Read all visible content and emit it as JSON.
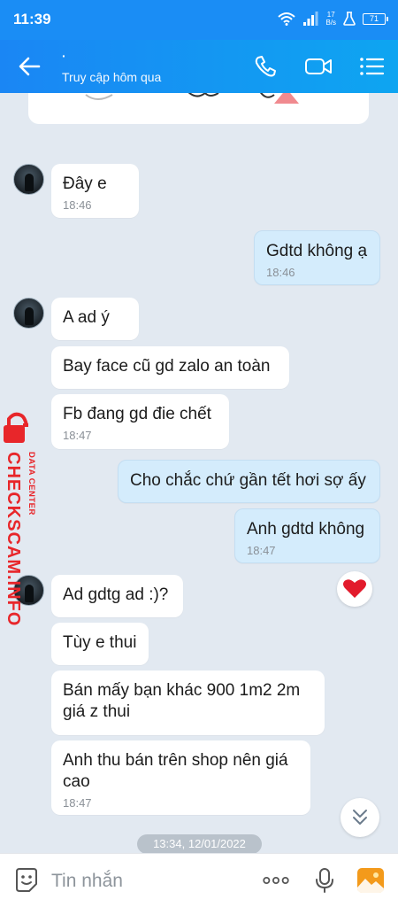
{
  "status_bar": {
    "time": "11:39",
    "net_speed_value": "17",
    "net_speed_unit": "B/s",
    "battery": "71",
    "icons": [
      "wifi-icon",
      "signal-icon",
      "flask-icon",
      "battery-icon"
    ]
  },
  "header": {
    "contact_name": "·",
    "status": "Truy cập hôm qua",
    "icons": [
      "back-arrow-icon",
      "phone-icon",
      "video-call-icon",
      "menu-list-icon"
    ],
    "accent_color": "#1a8df5"
  },
  "messages": [
    {
      "dir": "in",
      "text": "Đây e",
      "time": "18:46"
    },
    {
      "dir": "out",
      "text": "Gdtd không ạ",
      "time": "18:46"
    },
    {
      "dir": "in",
      "text": "A ad ý",
      "time": ""
    },
    {
      "dir": "in",
      "text": "Bay face cũ gd zalo an toàn",
      "time": ""
    },
    {
      "dir": "in",
      "text": "Fb đang gd đie chết",
      "time": "18:47"
    },
    {
      "dir": "out",
      "text": "Cho chắc chứ gần tết hơi sợ ấy",
      "time": ""
    },
    {
      "dir": "out",
      "text": "Anh gdtd không",
      "time": "18:47"
    },
    {
      "dir": "in",
      "text": "Ad gdtg ad :)?",
      "time": ""
    },
    {
      "dir": "in",
      "text": "Tùy e thui",
      "time": ""
    },
    {
      "dir": "in",
      "text": "Bán mấy bạn khác 900 1m2 2m giá z thui",
      "time": ""
    },
    {
      "dir": "in",
      "text": "Anh thu bán trên shop nên giá cao",
      "time": "18:47"
    }
  ],
  "reaction": "heart-icon",
  "date_badge": "13:34, 12/01/2022",
  "watermark": {
    "text": "CHECKSCAM.INFO",
    "subtext": "DATA CENTER",
    "color": "#e8262a"
  },
  "input_bar": {
    "placeholder": "Tin nhắn",
    "icons": [
      "sticker-icon",
      "more-dots-icon",
      "microphone-icon",
      "image-icon"
    ]
  }
}
